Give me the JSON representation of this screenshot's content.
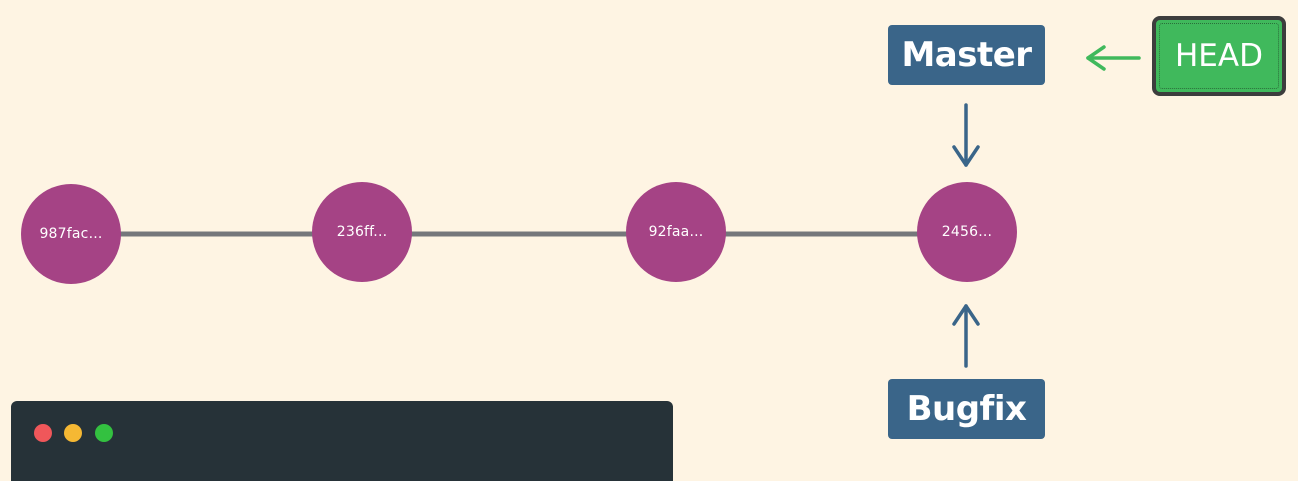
{
  "colors": {
    "background": "#fef4e3",
    "commit": "#a54385",
    "branch": "#3a6589",
    "head": "#40b95c",
    "line": "#75777b",
    "terminal": "#263238",
    "dot_red": "#f0575a",
    "dot_yellow": "#f5b833",
    "dot_green": "#33c140"
  },
  "commits": [
    {
      "label": "987fac..."
    },
    {
      "label": "236ff..."
    },
    {
      "label": "92faa..."
    },
    {
      "label": "2456..."
    }
  ],
  "branches": {
    "master": {
      "label": "Master"
    },
    "bugfix": {
      "label": "Bugfix"
    }
  },
  "head": {
    "label": "HEAD"
  },
  "icons": {
    "master_arrow": "arrow-down-icon",
    "bugfix_arrow": "arrow-up-icon",
    "head_arrow": "arrow-left-icon"
  }
}
